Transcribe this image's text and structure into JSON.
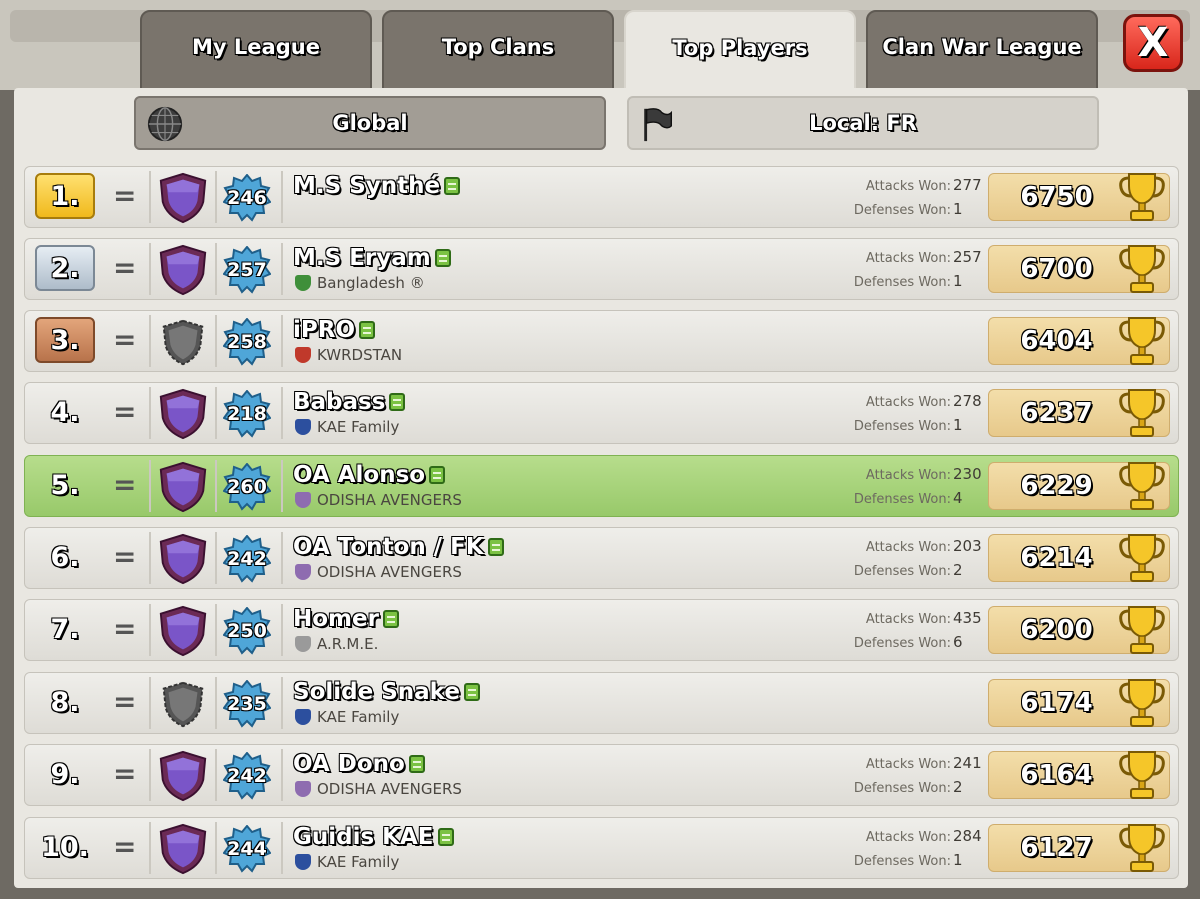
{
  "tabs": [
    {
      "label": "My League"
    },
    {
      "label": "Top Clans"
    },
    {
      "label": "Top Players"
    },
    {
      "label": "Clan War League"
    }
  ],
  "close_label": "X",
  "filters": {
    "global": "Global",
    "local": "Local: FR"
  },
  "stat_labels": {
    "attacks": "Attacks Won:",
    "defenses": "Defenses Won:"
  },
  "players": [
    {
      "rank": "1.",
      "trend": "=",
      "level": "246",
      "name": "M.S Synthé",
      "clan": "",
      "attacks": "277",
      "defenses": "1",
      "trophies": "6750"
    },
    {
      "rank": "2.",
      "trend": "=",
      "level": "257",
      "name": "M.S Eryam",
      "clan": "Bangladesh ®",
      "attacks": "257",
      "defenses": "1",
      "trophies": "6700"
    },
    {
      "rank": "3.",
      "trend": "=",
      "level": "258",
      "name": "iPRO",
      "clan": "KWRDSTAN",
      "attacks": "",
      "defenses": "",
      "trophies": "6404"
    },
    {
      "rank": "4.",
      "trend": "=",
      "level": "218",
      "name": "Babass",
      "clan": "KAE Family",
      "attacks": "278",
      "defenses": "1",
      "trophies": "6237"
    },
    {
      "rank": "5.",
      "trend": "=",
      "level": "260",
      "name": "OA Alonso",
      "clan": "ODISHA AVENGERS",
      "attacks": "230",
      "defenses": "4",
      "trophies": "6229"
    },
    {
      "rank": "6.",
      "trend": "=",
      "level": "242",
      "name": "OA Tonton / FK",
      "clan": "ODISHA AVENGERS",
      "attacks": "203",
      "defenses": "2",
      "trophies": "6214"
    },
    {
      "rank": "7.",
      "trend": "=",
      "level": "250",
      "name": "Homer",
      "clan": "A.R.M.E.",
      "attacks": "435",
      "defenses": "6",
      "trophies": "6200"
    },
    {
      "rank": "8.",
      "trend": "=",
      "level": "235",
      "name": "Solide Snake",
      "clan": "KAE Family",
      "attacks": "",
      "defenses": "",
      "trophies": "6174"
    },
    {
      "rank": "9.",
      "trend": "=",
      "level": "242",
      "name": "OA Dono",
      "clan": "ODISHA AVENGERS",
      "attacks": "241",
      "defenses": "2",
      "trophies": "6164"
    },
    {
      "rank": "10.",
      "trend": "=",
      "level": "244",
      "name": "Guidis KAE",
      "clan": "KAE Family",
      "attacks": "284",
      "defenses": "1",
      "trophies": "6127"
    }
  ]
}
